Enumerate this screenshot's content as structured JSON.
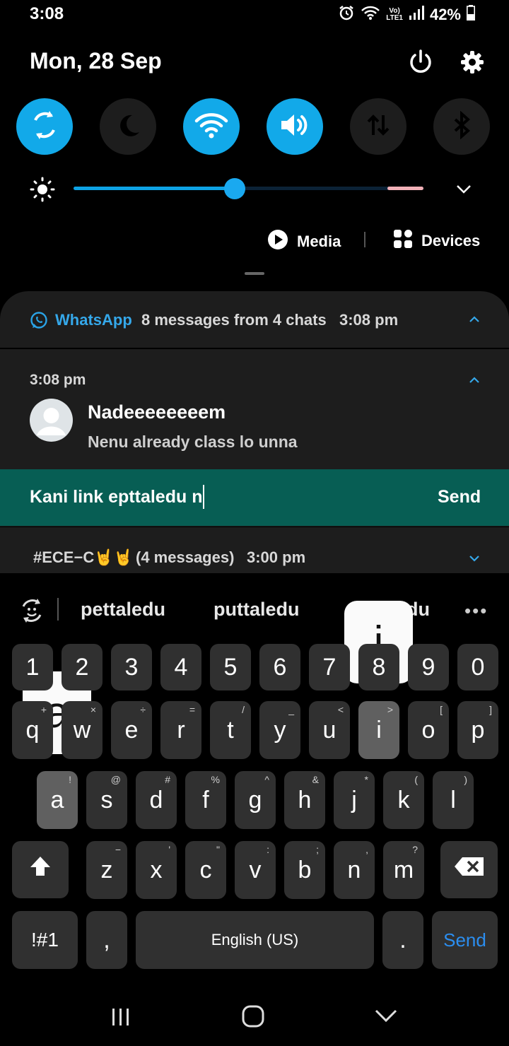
{
  "status_bar": {
    "time": "3:08",
    "network_label_top": "Vo)",
    "network_label_bottom": "LTE1",
    "battery_percent": "42%",
    "battery_level": 0.42
  },
  "quick_panel": {
    "date": "Mon, 28 Sep",
    "toggles": [
      {
        "name": "auto-rotate",
        "icon": "rotate-icon",
        "on": true
      },
      {
        "name": "night-mode",
        "icon": "moon-icon",
        "on": false
      },
      {
        "name": "wifi",
        "icon": "wifi-icon",
        "on": true
      },
      {
        "name": "sound",
        "icon": "volume-icon",
        "on": true
      },
      {
        "name": "mobile-data",
        "icon": "data-arrows-icon",
        "on": false
      },
      {
        "name": "bluetooth",
        "icon": "bluetooth-icon",
        "on": false
      }
    ],
    "brightness_level": 0.46,
    "media_label": "Media",
    "devices_label": "Devices"
  },
  "notifications": {
    "app_name": "WhatsApp",
    "summary": "8 messages from 4 chats",
    "header_time": "3:08 pm",
    "message_time": "3:08 pm",
    "sender": "Nadeeeeeeeem",
    "message": "Nenu already class lo unna",
    "reply_text": "Kani link epttaledu n",
    "send_label": "Send",
    "group_name": "#ECE−C🤘🤘",
    "group_count": "(4 messages)",
    "group_time": "3:00 pm"
  },
  "keyboard": {
    "suggestions": [
      "pettaledu",
      "puttaledu",
      "du"
    ],
    "number_row": [
      "1",
      "2",
      "3",
      "4",
      "5",
      "6",
      "7",
      "8",
      "9",
      "0"
    ],
    "row1": [
      {
        "k": "q",
        "s": "+"
      },
      {
        "k": "w",
        "s": "×"
      },
      {
        "k": "e",
        "s": "÷"
      },
      {
        "k": "r",
        "s": "="
      },
      {
        "k": "t",
        "s": "/"
      },
      {
        "k": "y",
        "s": "_"
      },
      {
        "k": "u",
        "s": "<"
      },
      {
        "k": "i",
        "s": ">"
      },
      {
        "k": "o",
        "s": "["
      },
      {
        "k": "p",
        "s": "]"
      }
    ],
    "row2": [
      {
        "k": "a",
        "s": "!"
      },
      {
        "k": "s",
        "s": "@"
      },
      {
        "k": "d",
        "s": "#"
      },
      {
        "k": "f",
        "s": "%"
      },
      {
        "k": "g",
        "s": "^"
      },
      {
        "k": "h",
        "s": "&"
      },
      {
        "k": "j",
        "s": "*"
      },
      {
        "k": "k",
        "s": "("
      },
      {
        "k": "l",
        "s": ")"
      }
    ],
    "row3": [
      {
        "k": "z",
        "s": "−"
      },
      {
        "k": "x",
        "s": "'"
      },
      {
        "k": "c",
        "s": "\""
      },
      {
        "k": "v",
        "s": ":"
      },
      {
        "k": "b",
        "s": ";"
      },
      {
        "k": "n",
        "s": ","
      },
      {
        "k": "m",
        "s": "?"
      }
    ],
    "symbols_label": "!#1",
    "comma_label": ",",
    "space_label": "English (US)",
    "period_label": ".",
    "send_label": "Send",
    "popup_a": "a",
    "popup_i": "i"
  }
}
